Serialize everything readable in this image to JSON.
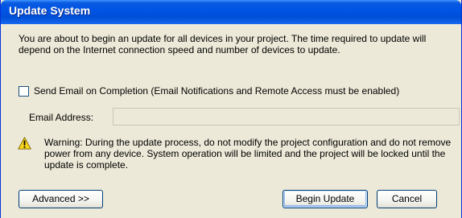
{
  "window": {
    "title": "Update System"
  },
  "intro_text": "You are about to begin an update for all devices in your project.  The time required to update will depend on the Internet connection speed and number of devices to update.",
  "email_option": {
    "checkbox_label": "Send Email on Completion (Email Notifications and Remote Access must be enabled)",
    "checked": false
  },
  "email_address": {
    "label": "Email Address:",
    "value": ""
  },
  "warning": {
    "icon": "warning-triangle-icon",
    "text": "Warning: During the update process, do not modify the project configuration and do not remove power from any device.  System operation will be limited and the project will be locked until the update is complete."
  },
  "buttons": {
    "advanced_label": "Advanced >>",
    "begin_update_label": "Begin Update",
    "cancel_label": "Cancel"
  },
  "colors": {
    "titlebar": "#0055e5",
    "dialog_background": "#ece9d8",
    "warning_yellow": "#f9d71c"
  }
}
